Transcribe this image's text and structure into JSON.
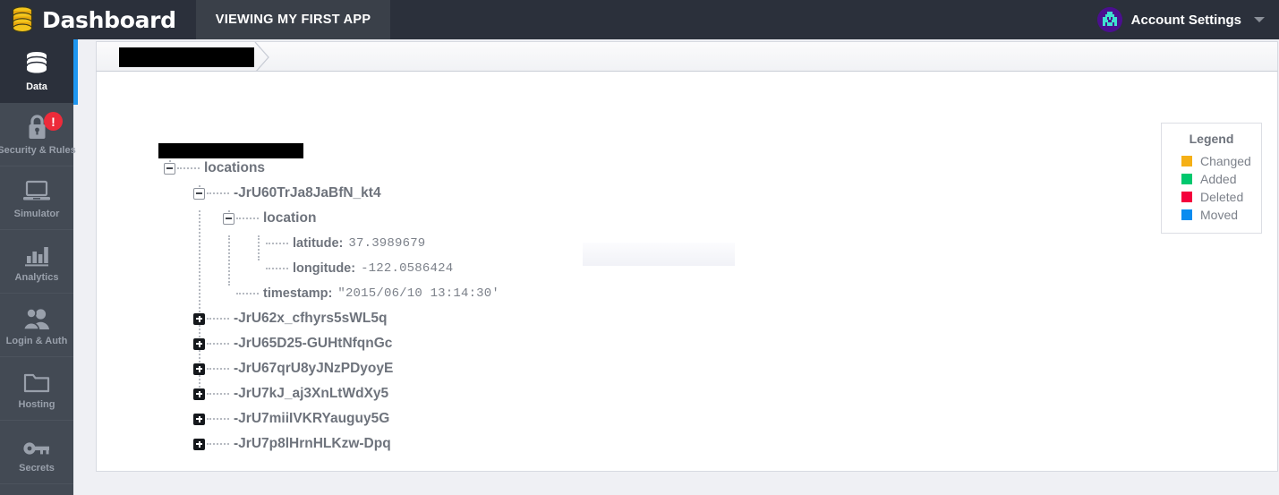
{
  "header": {
    "brand_title": "Dashboard",
    "logo_icon": "database-icon",
    "app_tab_label": "VIEWING MY FIRST APP",
    "account_label": "Account Settings",
    "avatar_icon": "alien-avatar",
    "caret_icon": "chevron-down-icon"
  },
  "sidebar": {
    "items": [
      {
        "label": "Data",
        "icon": "database-icon",
        "active": true,
        "badge": ""
      },
      {
        "label": "Security & Rules",
        "icon": "lock-icon",
        "active": false,
        "badge": "!"
      },
      {
        "label": "Simulator",
        "icon": "laptop-icon",
        "active": false,
        "badge": ""
      },
      {
        "label": "Analytics",
        "icon": "bar-chart-icon",
        "active": false,
        "badge": ""
      },
      {
        "label": "Login & Auth",
        "icon": "users-icon",
        "active": false,
        "badge": ""
      },
      {
        "label": "Hosting",
        "icon": "folder-icon",
        "active": false,
        "badge": ""
      },
      {
        "label": "Secrets",
        "icon": "key-icon",
        "active": false,
        "badge": ""
      }
    ],
    "accent_color": "#1e96f0",
    "badge_color": "#ed2b3a"
  },
  "breadcrumb": {
    "crumb_label": "",
    "redacted": true,
    "chevron_icon": "breadcrumb-chevron-icon"
  },
  "tree": {
    "root_label": "",
    "root_redacted": true,
    "nodes": [
      {
        "label": "locations",
        "toggle": "minus",
        "depth": 0
      },
      {
        "label": "-JrU60TrJa8JaBfN_kt4",
        "toggle": "minus",
        "depth": 1
      },
      {
        "label": "location",
        "toggle": "minus",
        "depth": 2
      },
      {
        "label": "-JrU62x_cfhyrs5sWL5q",
        "toggle": "plus",
        "depth": 1
      },
      {
        "label": "-JrU65D25-GUHtNfqnGc",
        "toggle": "plus",
        "depth": 1
      },
      {
        "label": "-JrU67qrU8yJNzPDyoyE",
        "toggle": "plus",
        "depth": 1
      },
      {
        "label": "-JrU7kJ_aj3XnLtWdXy5",
        "toggle": "plus",
        "depth": 1
      },
      {
        "label": "-JrU7miiIVKRYauguy5G",
        "toggle": "plus",
        "depth": 1
      },
      {
        "label": "-JrU7p8lHrnHLKzw-Dpq",
        "toggle": "plus",
        "depth": 1
      }
    ],
    "leaves": [
      {
        "key": "latitude:",
        "value": "37.3989679"
      },
      {
        "key": "longitude:",
        "value": "-122.0586424"
      },
      {
        "key": "timestamp:",
        "value": "\"2015/06/10 13:14:30'"
      }
    ]
  },
  "legend": {
    "title": "Legend",
    "rows": [
      {
        "label": "Changed",
        "color": "#f5b016"
      },
      {
        "label": "Added",
        "color": "#00c86e"
      },
      {
        "label": "Deleted",
        "color": "#f4003c"
      },
      {
        "label": "Moved",
        "color": "#0a8cf0"
      }
    ]
  }
}
